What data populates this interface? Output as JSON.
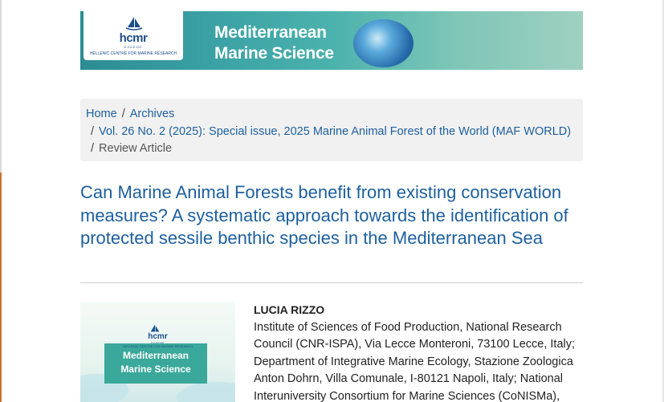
{
  "header": {
    "logo_word": "hcmr",
    "logo_sub": "ΕΛΚΕΘΕ",
    "logo_full": "HELLENIC CENTRE FOR MARINE RESEARCH",
    "journal_title_line1": "Mediterranean",
    "journal_title_line2": "Marine Science"
  },
  "breadcrumb": {
    "home": "Home",
    "separator": "/",
    "archives": "Archives",
    "issue": "Vol. 26 No. 2 (2025): Special issue, 2025 Marine Animal Forest of the World (MAF WORLD)",
    "current": "Review Article"
  },
  "article": {
    "title": "Can Marine Animal Forests benefit from existing conservation measures? A systematic approach towards the identification of protected sessile benthic species in the Mediterranean Sea"
  },
  "cover": {
    "logo_word": "hcmr",
    "logo_sub": "ΕΛΚΕΘΕ",
    "logo_full": "HELLENIC CENTRE FOR MARINE RESEARCH",
    "title_line1": "Mediterranean",
    "title_line2": "Marine Science"
  },
  "author": {
    "name": "LUCIA RIZZO",
    "affiliation": "Institute of Sciences of Food Production, National Research Council (CNR-ISPA), Via Lecce Monteroni, 73100 Lecce, Italy; Department of Integrative Marine Ecology, Stazione Zoologica Anton Dohrn, Villa Comunale, I-80121 Napoli, Italy; National Interuniversity Consortium for Marine Sciences (CoNISMa),"
  },
  "colors": {
    "link": "#1d5f9e",
    "banner_teal": "#3aa0a4",
    "breadcrumb_bg": "#f1f1f1",
    "side_accent": "#c8742b"
  }
}
